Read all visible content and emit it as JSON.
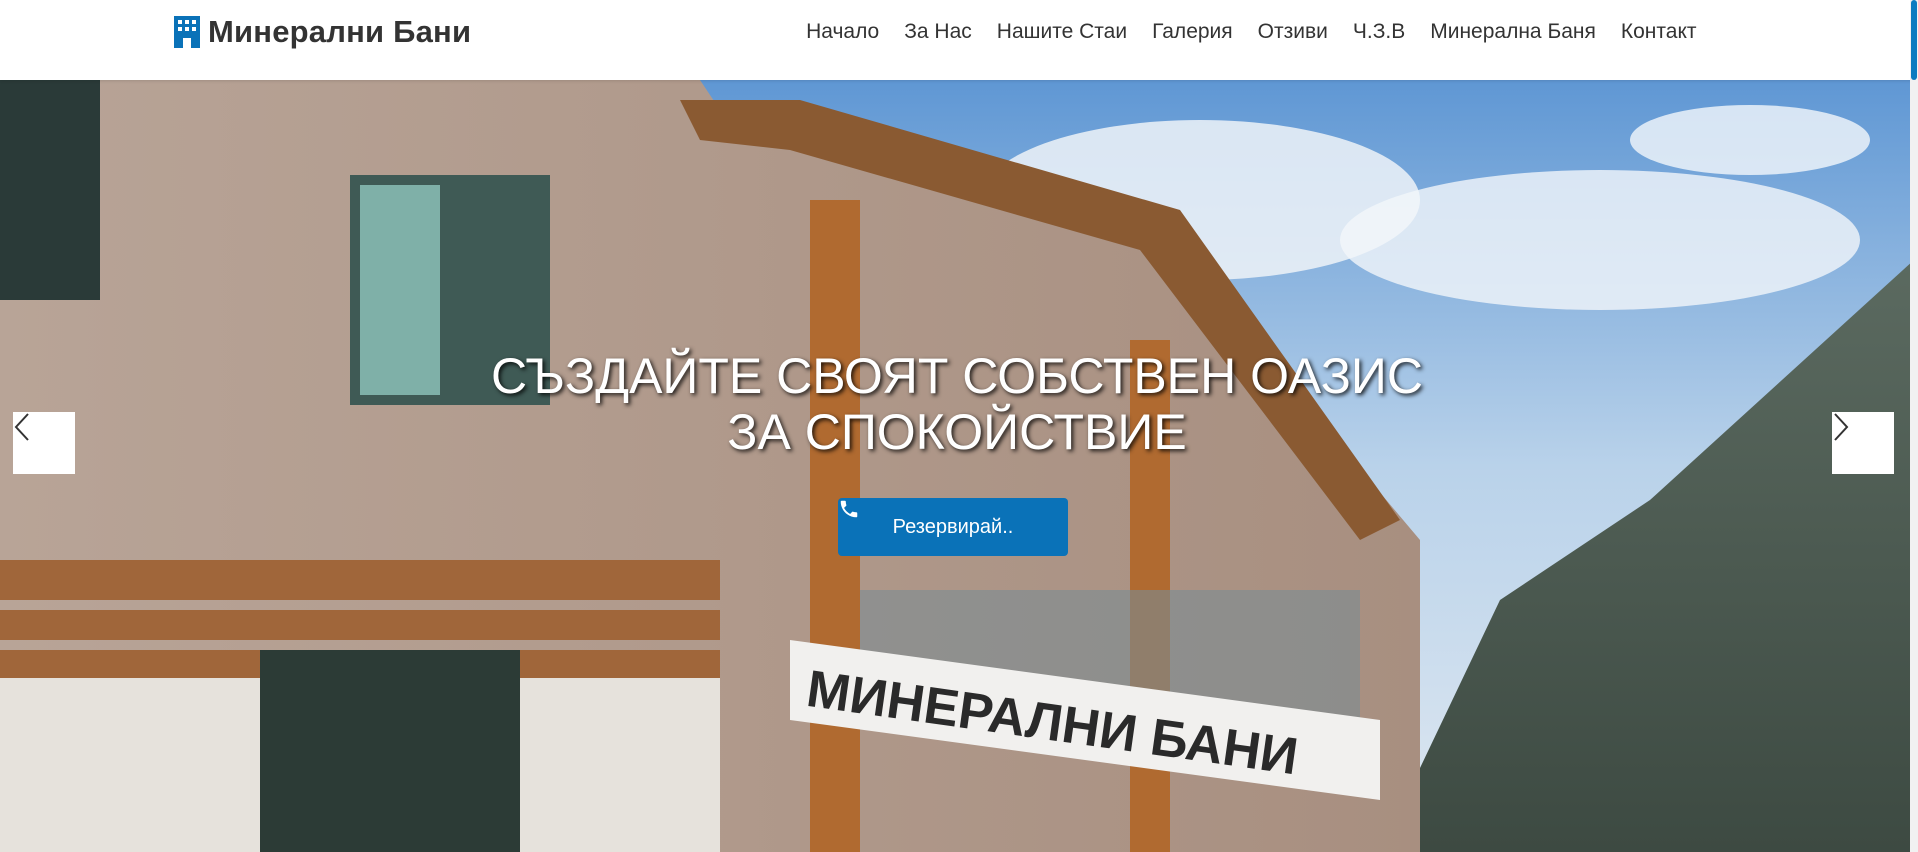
{
  "brand": {
    "name": "Минерални Бани",
    "icon": "hotel-icon",
    "color": "#0a72b8"
  },
  "nav": {
    "items": [
      {
        "label": "Начало"
      },
      {
        "label": "За Нас"
      },
      {
        "label": "Нашите Стаи"
      },
      {
        "label": "Галерия"
      },
      {
        "label": "Отзиви"
      },
      {
        "label": "Ч.З.В"
      },
      {
        "label": "Минерална Баня"
      },
      {
        "label": "Контакт"
      }
    ]
  },
  "hero": {
    "headline_line1": "СЪЗДАЙТЕ СВОЯТ СОБСТВЕН ОАЗИС",
    "headline_line2": "ЗА СПОКОЙСТВИЕ",
    "cta_label": "Резервирай..",
    "cta_icon": "phone-icon",
    "sign_text": "МИНЕРАЛНИ БАНИ",
    "prev_icon": "chevron-left-icon",
    "next_icon": "chevron-right-icon"
  }
}
